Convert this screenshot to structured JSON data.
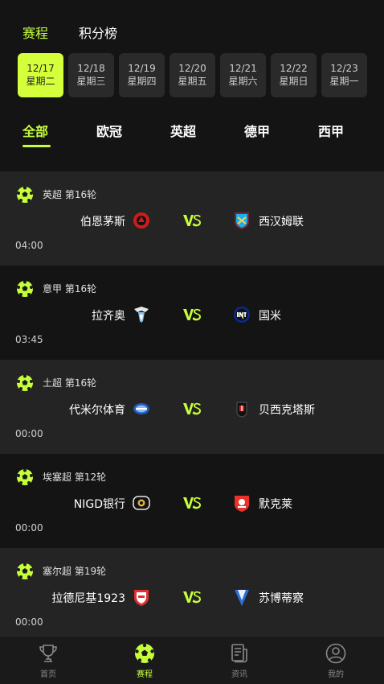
{
  "header": {
    "tabs": [
      {
        "label": "赛程",
        "active": true
      },
      {
        "label": "积分榜",
        "active": false
      }
    ]
  },
  "dates": [
    {
      "date": "12/17",
      "weekday": "星期二",
      "active": true
    },
    {
      "date": "12/18",
      "weekday": "星期三",
      "active": false
    },
    {
      "date": "12/19",
      "weekday": "星期四",
      "active": false
    },
    {
      "date": "12/20",
      "weekday": "星期五",
      "active": false
    },
    {
      "date": "12/21",
      "weekday": "星期六",
      "active": false
    },
    {
      "date": "12/22",
      "weekday": "星期日",
      "active": false
    },
    {
      "date": "12/23",
      "weekday": "星期一",
      "active": false
    }
  ],
  "leagues": [
    {
      "label": "全部",
      "active": true
    },
    {
      "label": "欧冠",
      "active": false
    },
    {
      "label": "英超",
      "active": false
    },
    {
      "label": "德甲",
      "active": false
    },
    {
      "label": "西甲",
      "active": false
    }
  ],
  "matches": [
    {
      "competition": "英超 第16轮",
      "home": "伯恩茅斯",
      "away": "西汉姆联",
      "time": "04:00"
    },
    {
      "competition": "意甲 第16轮",
      "home": "拉齐奥",
      "away": "国米",
      "time": "03:45"
    },
    {
      "competition": "土超 第16轮",
      "home": "代米尔体育",
      "away": "贝西克塔斯",
      "time": "00:00"
    },
    {
      "competition": "埃塞超 第12轮",
      "home": "NIGD银行",
      "away": "默克莱",
      "time": "00:00"
    },
    {
      "competition": "塞尔超 第19轮",
      "home": "拉德尼基1923",
      "away": "苏博蒂察",
      "time": "00:00"
    }
  ],
  "bottom_nav": [
    {
      "label": "首页",
      "icon": "trophy-icon",
      "active": false
    },
    {
      "label": "赛程",
      "icon": "football-icon",
      "active": true
    },
    {
      "label": "资讯",
      "icon": "news-icon",
      "active": false
    },
    {
      "label": "我的",
      "icon": "profile-icon",
      "active": false
    }
  ],
  "colors": {
    "accent": "#c6ff3a",
    "background": "#141414",
    "row_alt": "#242424"
  }
}
